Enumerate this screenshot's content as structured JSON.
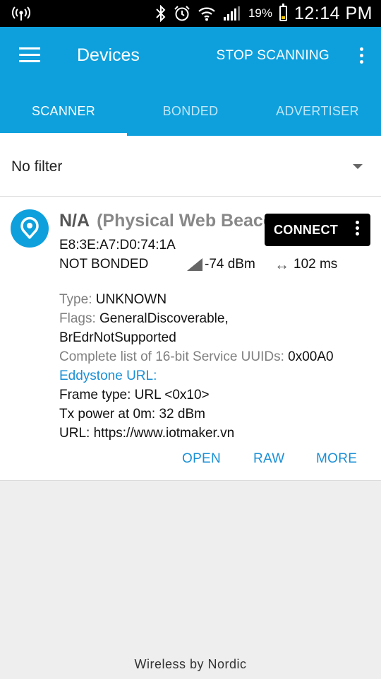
{
  "status_bar": {
    "battery_pct": "19%",
    "time": "12:14 PM",
    "icons": [
      "hotspot-icon",
      "bluetooth-icon",
      "alarm-icon",
      "wifi-icon",
      "signal-icon",
      "battery-icon"
    ],
    "battery_color": "#f5c400"
  },
  "app_bar": {
    "title": "Devices",
    "stop_scanning": "STOP SCANNING",
    "color": "#0ea0dd"
  },
  "tabs": [
    {
      "label": "SCANNER",
      "active": true
    },
    {
      "label": "BONDED",
      "active": false
    },
    {
      "label": "ADVERTISER",
      "active": false
    }
  ],
  "filter": {
    "value": "No filter"
  },
  "device": {
    "name": "N/A",
    "type_label": "(Physical Web Beacon)",
    "mac": "E8:3E:A7:D0:74:1A",
    "bond_state": "NOT BONDED",
    "rssi": "-74 dBm",
    "interval": "102 ms",
    "connect_label": "CONNECT",
    "details": {
      "type_key": "Type:",
      "type_val": "UNKNOWN",
      "flags_key": "Flags:",
      "flags_val1": "GeneralDiscoverable,",
      "flags_val2": "BrEdrNotSupported",
      "uuids_key": "Complete list of 16-bit Service UUIDs:",
      "uuids_val": "0x00A0",
      "eddystone_label": "Eddystone URL:",
      "frame_type": "Frame type: URL <0x10>",
      "tx_power": "Tx power at 0m: 32 dBm",
      "url": "URL: https://www.iotmaker.vn"
    },
    "actions": {
      "open": "OPEN",
      "raw": "RAW",
      "more": "MORE"
    }
  },
  "footer": {
    "text": "Wireless by Nordic"
  }
}
